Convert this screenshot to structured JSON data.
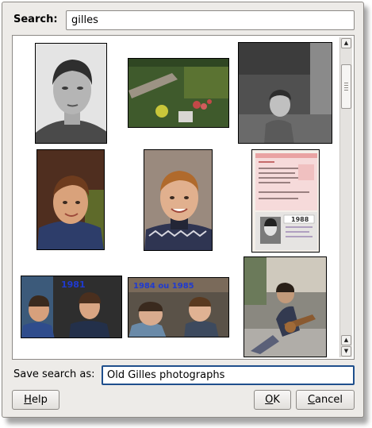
{
  "search": {
    "label": "Search:",
    "value": "gilles"
  },
  "save": {
    "label": "Save search as:",
    "value": "Old Gilles photographs"
  },
  "photos": [
    {
      "name": "portrait-young-man-bw"
    },
    {
      "name": "garden-aerial"
    },
    {
      "name": "boy-bw-street"
    },
    {
      "name": "boy-jacket-color"
    },
    {
      "name": "boy-sweater-color"
    },
    {
      "name": "student-card",
      "year": "1988"
    },
    {
      "name": "boys-1981",
      "caption": "1981"
    },
    {
      "name": "boys-1984-1985",
      "caption": "1984 ou 1985"
    },
    {
      "name": "teen-guitar"
    }
  ],
  "buttons": {
    "help": {
      "mnemonic": "H",
      "rest": "elp"
    },
    "ok": {
      "mnemonic": "O",
      "rest": "K"
    },
    "cancel": {
      "mnemonic": "C",
      "rest": "ancel"
    }
  },
  "colors": {
    "accent": "#1f4f8c"
  }
}
